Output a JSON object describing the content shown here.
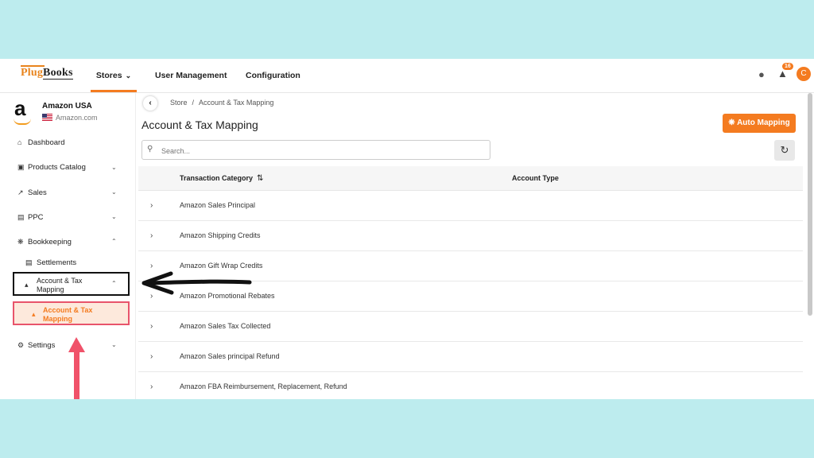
{
  "logo": {
    "part1": "Plug",
    "part2": "Books"
  },
  "nav": {
    "stores": "Stores",
    "user_management": "User Management",
    "configuration": "Configuration"
  },
  "header": {
    "notification_count": "16",
    "avatar_initial": "C"
  },
  "store": {
    "name": "Amazon USA",
    "domain": "Amazon.com"
  },
  "sidebar": {
    "dashboard": "Dashboard",
    "products_catalog": "Products Catalog",
    "sales": "Sales",
    "ppc": "PPC",
    "bookkeeping": "Bookkeeping",
    "settlements": "Settlements",
    "account_tax_mapping_group": "Account & Tax Mapping",
    "account_tax_mapping_item": "Account & Tax Mapping",
    "settings": "Settings"
  },
  "breadcrumb": {
    "store": "Store",
    "separator": "/",
    "current": "Account & Tax Mapping"
  },
  "page": {
    "title": "Account & Tax Mapping",
    "auto_mapping": "Auto Mapping"
  },
  "search": {
    "placeholder": "Search..."
  },
  "table": {
    "columns": [
      "Transaction Category",
      "Account Type"
    ],
    "rows": [
      "Amazon Sales Principal",
      "Amazon Shipping Credits",
      "Amazon Gift Wrap Credits",
      "Amazon Promotional Rebates",
      "Amazon Sales Tax Collected",
      "Amazon Sales principal Refund",
      "Amazon FBA Reimbursement, Replacement, Refund"
    ]
  },
  "colors": {
    "accent": "#f47b20",
    "highlight_border": "#e8546b",
    "background": "#bdecee"
  }
}
